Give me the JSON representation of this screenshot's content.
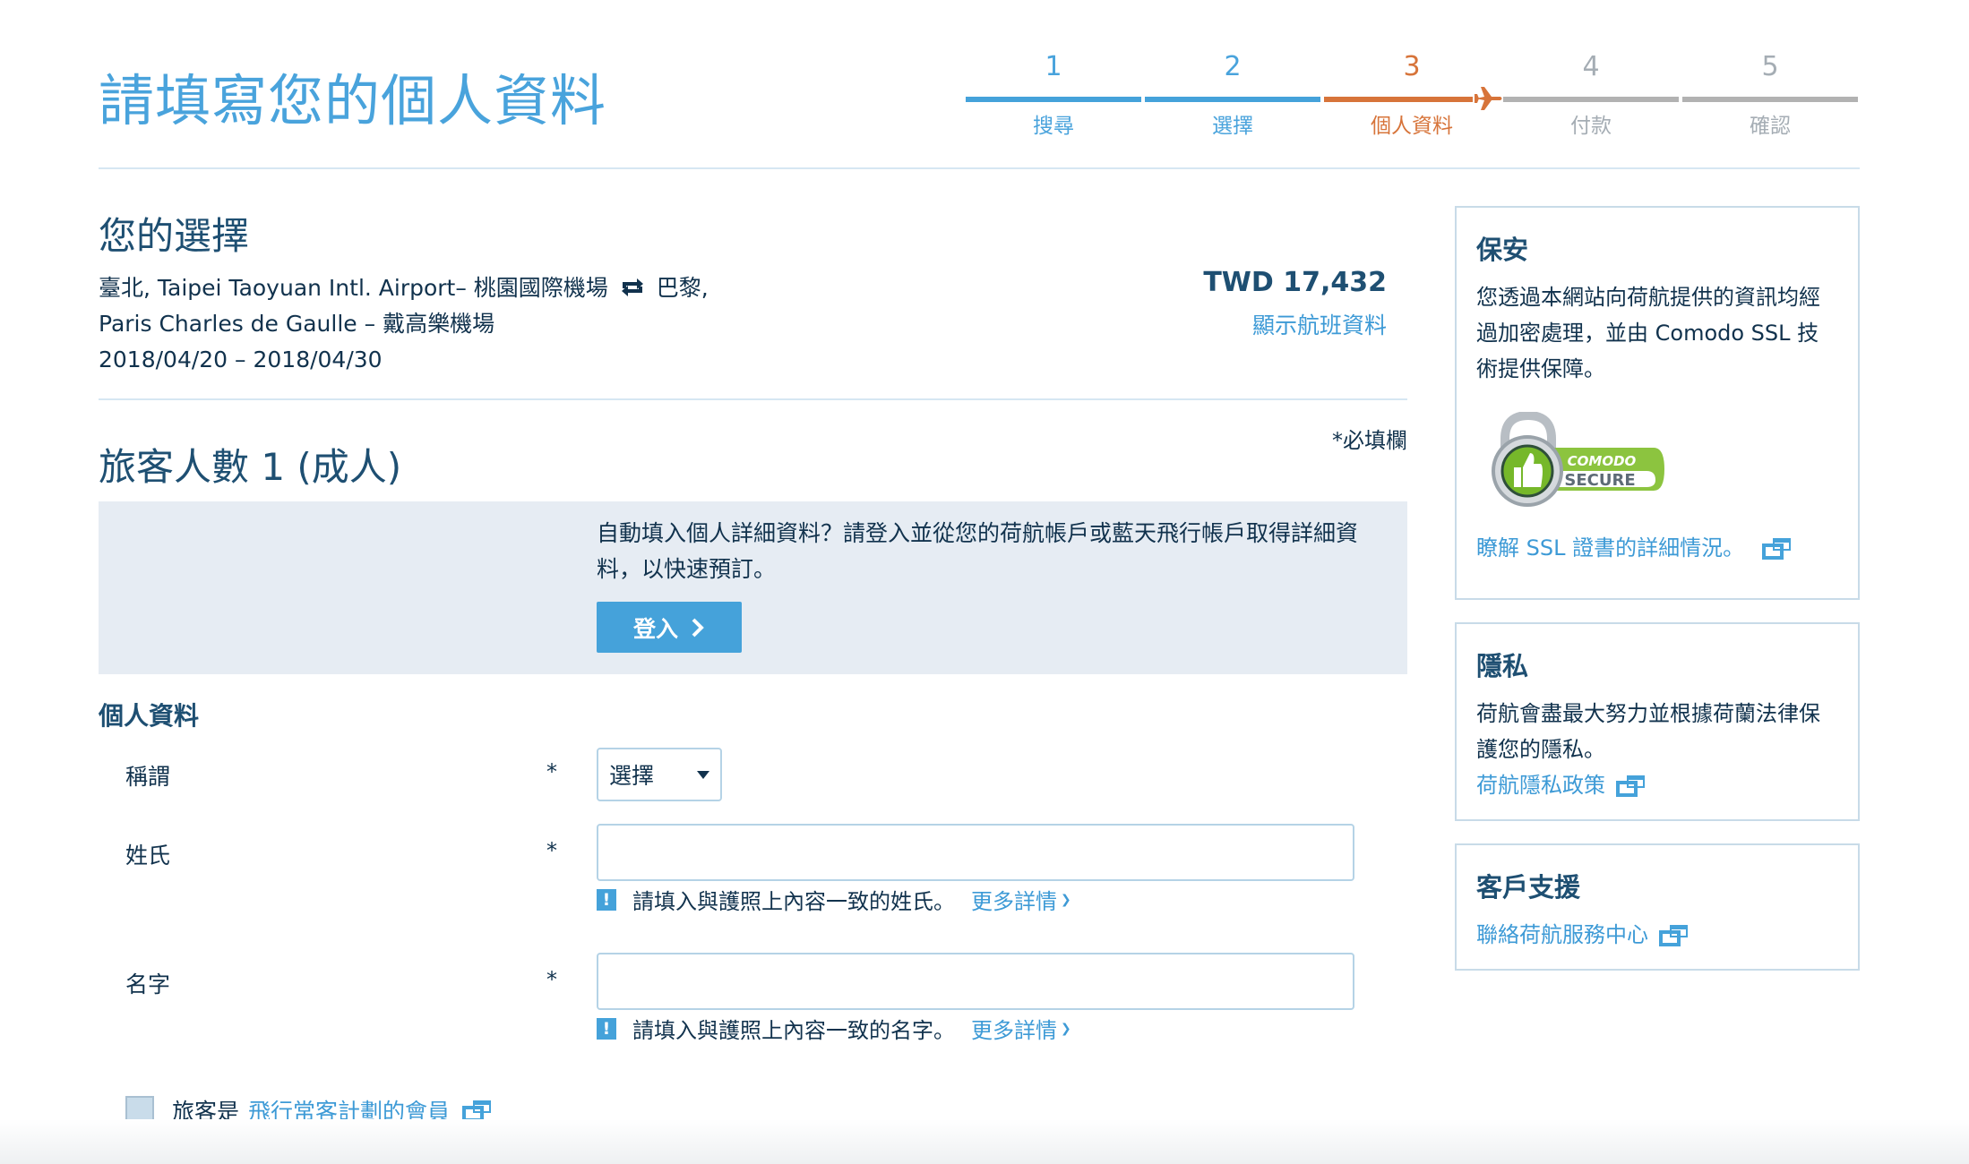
{
  "header": {
    "title": "請填寫您的個人資料",
    "steps": [
      {
        "num": "1",
        "label": "搜尋",
        "state": "done"
      },
      {
        "num": "2",
        "label": "選擇",
        "state": "done"
      },
      {
        "num": "3",
        "label": "個人資料",
        "state": "current"
      },
      {
        "num": "4",
        "label": "付款",
        "state": "todo"
      },
      {
        "num": "5",
        "label": "確認",
        "state": "todo"
      }
    ],
    "current_step": 3,
    "total_steps": 5
  },
  "selection": {
    "heading": "您的選擇",
    "origin": "臺北, Taipei Taoyuan Intl. Airport– 桃園國際機場",
    "trip_type_icon": "round-trip-swap-icon",
    "destination_city": "巴黎,",
    "destination_airport": "Paris Charles de Gaulle – 戴高樂機場",
    "dates": "2018/04/20 – 2018/04/30",
    "price": "TWD 17,432",
    "flight_details_link": "顯示航班資料"
  },
  "passengers": {
    "heading": "旅客人數 1 (成人)",
    "required_note": "*必填欄",
    "login_prompt": "自動填入個人詳細資料？請登入並從您的荷航帳戶或藍天飛行帳戶取得詳細資料，以快速預訂。",
    "login_button": "登入"
  },
  "form": {
    "heading": "個人資料",
    "required_mark": "*",
    "title_field": {
      "label": "稱謂",
      "selected": "選擇"
    },
    "last_name": {
      "label": "姓氏",
      "value": "",
      "help": "請填入與護照上內容一致的姓氏。",
      "more": "更多詳情"
    },
    "first_name": {
      "label": "名字",
      "value": "",
      "help": "請填入與護照上內容一致的名字。",
      "more": "更多詳情"
    },
    "ffp": {
      "prefix": "旅客是",
      "link": "飛行常客計劃的會員",
      "checked": false
    }
  },
  "sidebar": {
    "security": {
      "title": "保安",
      "text": "您透過本網站向荷航提供的資訊均經過加密處理，並由 Comodo SSL 技術提供保障。",
      "badge_top": "COMODO",
      "badge_bottom": "SECURE",
      "link": "瞭解 SSL 證書的詳細情況。"
    },
    "privacy": {
      "title": "隱私",
      "text": "荷航會盡最大努力並根據荷蘭法律保護您的隱私。",
      "link": "荷航隱私政策"
    },
    "support": {
      "title": "客戶支援",
      "link": "聯絡荷航服務中心"
    }
  },
  "colors": {
    "accent_blue": "#45a2da",
    "current_orange": "#d7743a",
    "inactive_gray": "#b2b2b2",
    "heading_navy": "#1e4f72"
  }
}
